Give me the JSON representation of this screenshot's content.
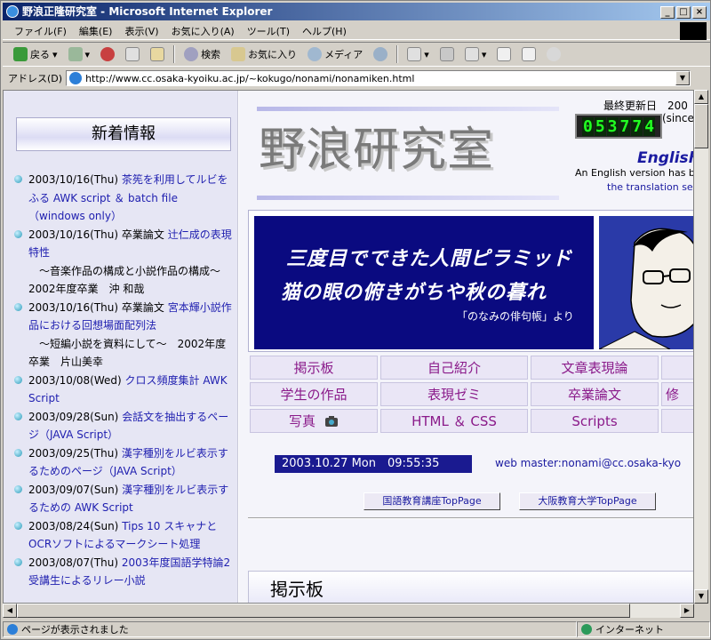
{
  "window": {
    "title": "野浪正隆研究室 - Microsoft Internet Explorer",
    "controls": {
      "minimize": "_",
      "maximize": "□",
      "close": "×"
    }
  },
  "menu": [
    "ファイル(F)",
    "編集(E)",
    "表示(V)",
    "お気に入り(A)",
    "ツール(T)",
    "ヘルプ(H)"
  ],
  "toolbar": {
    "back": "戻る",
    "search": "検索",
    "favorites": "お気に入り",
    "media": "メディア"
  },
  "address": {
    "label": "アドレス(D)",
    "url": "http://www.cc.osaka-kyoiku.ac.jp/~kokugo/nonami/nonamiken.html"
  },
  "sidebar": {
    "title": "新着情報",
    "news": [
      {
        "date": "2003/10/16(Thu)",
        "pre": "",
        "link": "茶筅を利用してルビをふる AWK script ＆ batch file（windows only）",
        "post": ""
      },
      {
        "date": "2003/10/16(Thu)",
        "pre": "卒業論文",
        "link": "辻仁成の表現特性",
        "post": "～音楽作品の構成と小説作品の構成～　2002年度卒業　沖 和哉"
      },
      {
        "date": "2003/10/16(Thu)",
        "pre": "卒業論文",
        "link": "宮本輝小説作品における回想場面配列法",
        "post": "～短編小説を資料にして～　2002年度卒業　片山美幸"
      },
      {
        "date": "2003/10/08(Wed)",
        "pre": "",
        "link": "クロス頻度集計 AWK Script",
        "post": ""
      },
      {
        "date": "2003/09/28(Sun)",
        "pre": "",
        "link": "会話文を抽出するページ（JAVA Script）",
        "post": ""
      },
      {
        "date": "2003/09/25(Thu)",
        "pre": "",
        "link": "漢字種別をルビ表示するためのページ（JAVA Script）",
        "post": ""
      },
      {
        "date": "2003/09/07(Sun)",
        "pre": "",
        "link": "漢字種別をルビ表示するための AWK Script",
        "post": ""
      },
      {
        "date": "2003/08/24(Sun)",
        "pre": "",
        "link": "Tips 10 スキャナとOCRソフトによるマークシート処理",
        "post": ""
      },
      {
        "date": "2003/08/07(Thu)",
        "pre": "",
        "link": "2003年度国語学特論2受講生によるリレー小説",
        "post": ""
      }
    ]
  },
  "main": {
    "title": "野浪研究室",
    "last_updated_label": "最終更新日　200",
    "since_label": "(since",
    "counter": [
      "0",
      "5",
      "3",
      "7",
      "7",
      "4"
    ],
    "english": "English",
    "english_note": "An English version has be",
    "english_link": "the translation serv",
    "banner": {
      "line1": "三度目でできた人間ピラミッド",
      "line2": "猫の眼の俯きがちや秋の暮れ",
      "source": "「のなみの俳句帳」より"
    },
    "nav": [
      [
        "掲示板",
        "自己紹介",
        "文章表現論"
      ],
      [
        "学生の作品",
        "表現ゼミ",
        "卒業論文",
        "修"
      ],
      [
        "写真",
        "HTML ＆ CSS",
        "Scripts"
      ]
    ],
    "datetime": "2003.10.27 Mon　09:55:35",
    "webmaster": "web master:nonami@cc.osaka-kyo",
    "buttons": [
      "国語教育講座TopPage",
      "大阪教育大学TopPage"
    ],
    "section_heading": "掲示板"
  },
  "status": {
    "left": "ページが表示されました",
    "zone": "インターネット"
  }
}
